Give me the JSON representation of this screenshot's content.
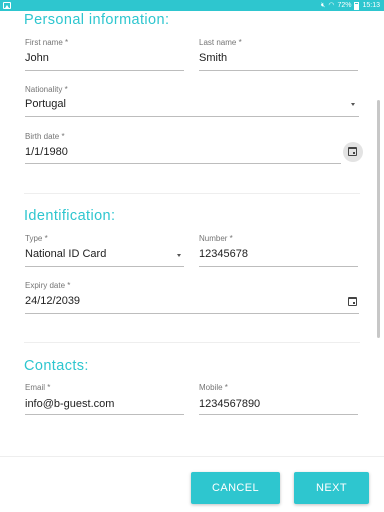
{
  "status_bar": {
    "battery": "72%",
    "time": "15:13"
  },
  "personal": {
    "title": "Personal information:",
    "first_name": {
      "label": "First name *",
      "value": "John"
    },
    "last_name": {
      "label": "Last name *",
      "value": "Smith"
    },
    "nationality": {
      "label": "Nationality *",
      "value": "Portugal"
    },
    "birth_date": {
      "label": "Birth date *",
      "value": "1/1/1980"
    }
  },
  "identification": {
    "title": "Identification:",
    "type": {
      "label": "Type *",
      "value": "National ID Card"
    },
    "number": {
      "label": "Number *",
      "value": "12345678"
    },
    "expiry": {
      "label": "Expiry date *",
      "value": "24/12/2039"
    }
  },
  "contacts": {
    "title": "Contacts:",
    "email": {
      "label": "Email *",
      "value": "info@b-guest.com"
    },
    "mobile": {
      "label": "Mobile *",
      "value": "1234567890"
    }
  },
  "actions": {
    "cancel": "CANCEL",
    "next": "NEXT"
  },
  "colors": {
    "accent": "#2ec6cf"
  },
  "icons": [
    "image-icon",
    "mute-icon",
    "wifi-icon",
    "battery-icon",
    "calendar-icon",
    "dropdown-arrow-icon"
  ]
}
